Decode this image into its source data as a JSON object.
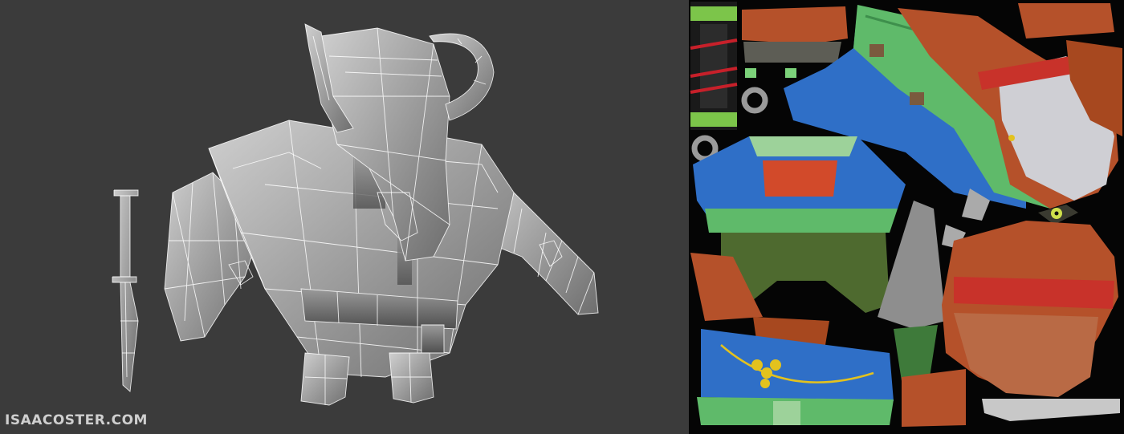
{
  "watermark": {
    "text": "ISAACOSTER.COM"
  },
  "viewport": {
    "icon": "wireframe-bull-model"
  },
  "uv_sheet": {
    "icon": "texture-atlas"
  },
  "colors": {
    "viewport_bg": "#3b3b3b",
    "model_shade": "#a9a9a9",
    "wire": "#ffffff",
    "uv_bg": "#050505",
    "fur": "#b5512a",
    "cloth_blue": "#2f6fc7",
    "cloth_green": "#5fba6a",
    "pants": "#4e6a2f",
    "bandana": "#c8322a",
    "skin": "#b96a45",
    "horn": "#8e8e8e",
    "gold": "#e3c21e"
  }
}
